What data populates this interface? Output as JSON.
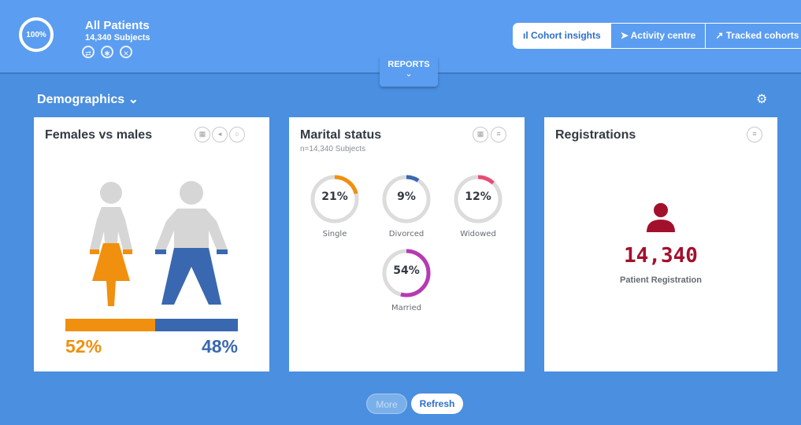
{
  "cohort": {
    "percent": "100%",
    "title": "All Patients",
    "subjects": "14,340 Subjects",
    "icons": [
      "swap-icon",
      "pin-icon",
      "close-icon"
    ]
  },
  "nav": {
    "cohort_insights": "Cohort insights",
    "activity_centre": "Activity centre",
    "tracked_cohorts": "Tracked cohorts"
  },
  "reports_label": "REPORTS",
  "section_title": "Demographics",
  "colors": {
    "female": "#f0900e",
    "male": "#3a68b0",
    "accent": "#b63ab2",
    "registration": "#a3102c"
  },
  "cards": {
    "gender": {
      "title": "Females vs males",
      "female_pct": "52%",
      "male_pct": "48%",
      "female_share": 0.52
    },
    "marital": {
      "title": "Marital status",
      "subtitle": "n=14,340 Subjects",
      "items": [
        {
          "label": "Single",
          "value": "21%",
          "fraction": 0.21,
          "color": "#f0900e"
        },
        {
          "label": "Divorced",
          "value": "9%",
          "fraction": 0.09,
          "color": "#3a68b0"
        },
        {
          "label": "Widowed",
          "value": "12%",
          "fraction": 0.12,
          "color": "#e64d74"
        },
        {
          "label": "Married",
          "value": "54%",
          "fraction": 0.54,
          "color": "#b63ab2"
        }
      ]
    },
    "registrations": {
      "title": "Registrations",
      "value": "14,340",
      "label": "Patient Registration"
    }
  },
  "buttons": {
    "more": "More",
    "refresh": "Refresh"
  }
}
